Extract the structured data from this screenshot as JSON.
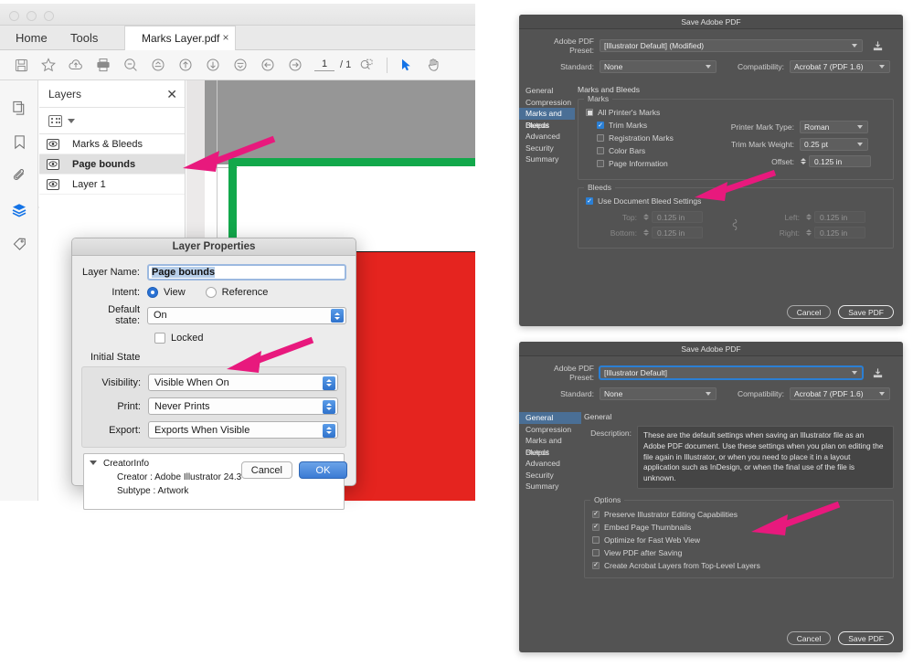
{
  "acrobat": {
    "window_title": "",
    "tabs": {
      "home": "Home",
      "tools": "Tools",
      "document": "Marks Layer.pdf",
      "close_glyph": "×"
    },
    "toolbar": {
      "page_current": "1",
      "page_total": "/ 1",
      "icons": [
        "save-icon",
        "star-icon",
        "upload-cloud-icon",
        "print-icon",
        "zoom-icon",
        "fit-width-icon",
        "up-arrow-icon",
        "down-arrow-icon",
        "fit-page-icon",
        "back-arrow-icon",
        "forward-arrow-icon",
        "select-zoom-icon",
        "pointer-icon",
        "hand-icon"
      ]
    },
    "rail": [
      "page-thumbnails-icon",
      "bookmarks-icon",
      "attachments-icon",
      "layers-icon",
      "tags-icon"
    ],
    "layers_panel": {
      "title": "Layers",
      "close_glyph": "✕",
      "layers": [
        {
          "name": "Marks & Bleeds",
          "selected": false
        },
        {
          "name": "Page bounds",
          "selected": true
        },
        {
          "name": "Layer 1",
          "selected": false
        }
      ]
    },
    "canvas": {
      "page_border_color": "#12a84b",
      "artwork_color": "#e5241f",
      "background_color": "#969696"
    }
  },
  "layer_properties": {
    "title": "Layer Properties",
    "layer_name_label": "Layer Name:",
    "layer_name_value": "Page bounds",
    "intent_label": "Intent:",
    "intent_view": "View",
    "intent_reference": "Reference",
    "intent_selected": "View",
    "default_state_label": "Default state:",
    "default_state_value": "On",
    "locked_label": "Locked",
    "locked_checked": false,
    "initial_state_label": "Initial State",
    "visibility_label": "Visibility:",
    "visibility_value": "Visible When On",
    "print_label": "Print:",
    "print_value": "Never Prints",
    "export_label": "Export:",
    "export_value": "Exports When Visible",
    "info": {
      "group": "CreatorInfo",
      "creator": "Creator : Adobe Illustrator 24.3",
      "subtype": "Subtype : Artwork"
    },
    "cancel": "Cancel",
    "ok": "OK"
  },
  "save_pdf_marks": {
    "title": "Save Adobe PDF",
    "preset_label": "Adobe PDF Preset:",
    "preset_value": "[Illustrator Default] (Modified)",
    "standard_label": "Standard:",
    "standard_value": "None",
    "compatibility_label": "Compatibility:",
    "compatibility_value": "Acrobat 7 (PDF 1.6)",
    "nav": [
      "General",
      "Compression",
      "Marks and Bleeds",
      "Output",
      "Advanced",
      "Security",
      "Summary"
    ],
    "nav_selected": "Marks and Bleeds",
    "pane_title": "Marks and Bleeds",
    "marks_group": "Marks",
    "all_printers_marks": {
      "label": "All Printer's Marks",
      "state": "mixed"
    },
    "mark_checks": [
      {
        "label": "Trim Marks",
        "checked": true
      },
      {
        "label": "Registration Marks",
        "checked": false
      },
      {
        "label": "Color Bars",
        "checked": false
      },
      {
        "label": "Page Information",
        "checked": false
      }
    ],
    "printer_mark_type_label": "Printer Mark Type:",
    "printer_mark_type_value": "Roman",
    "trim_mark_weight_label": "Trim Mark Weight:",
    "trim_mark_weight_value": "0.25 pt",
    "offset_label": "Offset:",
    "offset_value": "0.125 in",
    "bleeds_group": "Bleeds",
    "use_document_bleed": {
      "label": "Use Document Bleed Settings",
      "checked": true
    },
    "bleed_fields": [
      {
        "label": "Top:",
        "value": "0.125 in"
      },
      {
        "label": "Left:",
        "value": "0.125 in"
      },
      {
        "label": "Bottom:",
        "value": "0.125 in"
      },
      {
        "label": "Right:",
        "value": "0.125 in"
      }
    ],
    "cancel": "Cancel",
    "save": "Save PDF"
  },
  "save_pdf_general": {
    "title": "Save Adobe PDF",
    "preset_label": "Adobe PDF Preset:",
    "preset_value": "[Illustrator Default]",
    "standard_label": "Standard:",
    "standard_value": "None",
    "compatibility_label": "Compatibility:",
    "compatibility_value": "Acrobat 7 (PDF 1.6)",
    "nav": [
      "General",
      "Compression",
      "Marks and Bleeds",
      "Output",
      "Advanced",
      "Security",
      "Summary"
    ],
    "nav_selected": "General",
    "pane_title": "General",
    "description_label": "Description:",
    "description_value": "These are the default settings when saving an Illustrator file as an Adobe PDF document. Use these settings when you plan on editing the file again in Illustrator, or when you need to place it in a layout application such as InDesign, or when the final use of the file is unknown.",
    "options_group": "Options",
    "options": [
      {
        "label": "Preserve Illustrator Editing Capabilities",
        "checked": true
      },
      {
        "label": "Embed Page Thumbnails",
        "checked": true
      },
      {
        "label": "Optimize for Fast Web View",
        "checked": false
      },
      {
        "label": "View PDF after Saving",
        "checked": false
      },
      {
        "label": "Create Acrobat Layers from Top-Level Layers",
        "checked": true
      }
    ],
    "cancel": "Cancel",
    "save": "Save PDF"
  },
  "annotations": {
    "arrow_color": "#e8197d",
    "arrows": [
      {
        "name": "arrow-to-page-bounds-layer"
      },
      {
        "name": "arrow-to-print-never-prints"
      },
      {
        "name": "arrow-to-use-document-bleed-settings"
      },
      {
        "name": "arrow-to-create-acrobat-layers"
      }
    ]
  }
}
